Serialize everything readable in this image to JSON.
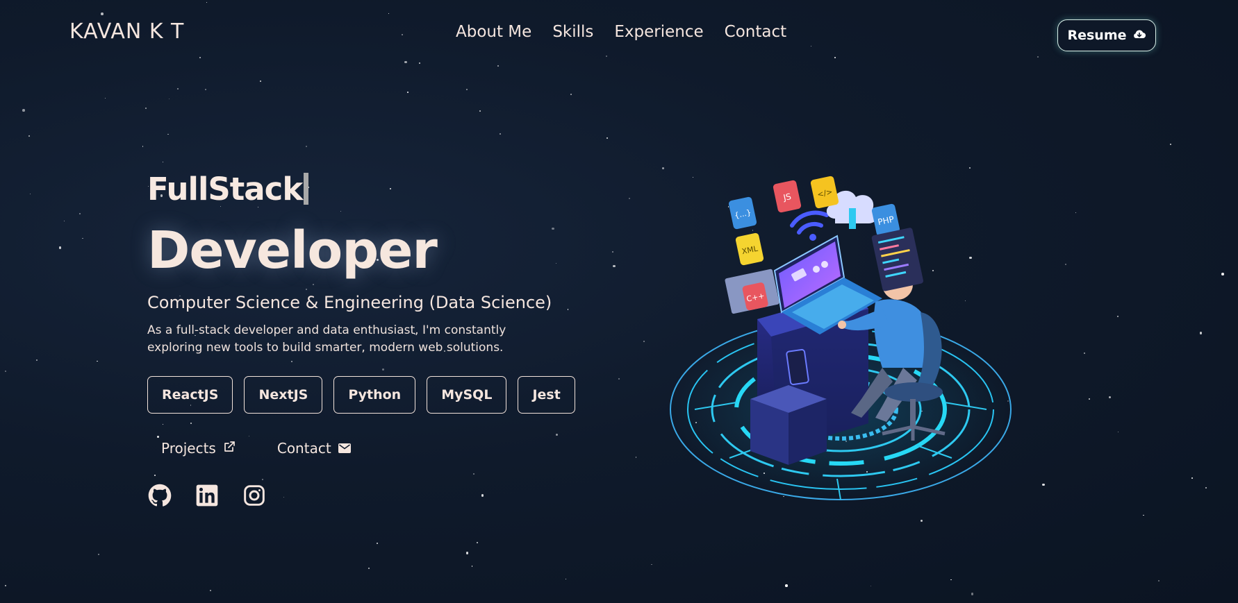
{
  "header": {
    "logo": "KAVAN K T",
    "nav": [
      "About Me",
      "Skills",
      "Experience",
      "Contact"
    ],
    "resume_label": "Resume",
    "resume_icon": "cloud-download-icon"
  },
  "hero": {
    "role_line_1": "FullStack",
    "role_line_2": "Developer",
    "degree": "Computer Science & Engineering (Data Science)",
    "bio": "As a full-stack developer and data enthusiast, I'm constantly exploring new tools to build smarter, modern web solutions.",
    "skills": [
      "ReactJS",
      "NextJS",
      "Python",
      "MySQL",
      "Jest"
    ],
    "links": [
      {
        "label": "Projects",
        "icon": "external-link-icon"
      },
      {
        "label": "Contact",
        "icon": "mail-icon"
      }
    ],
    "socials": [
      "github-icon",
      "linkedin-icon",
      "instagram-icon"
    ]
  },
  "illustration": {
    "badges": [
      "{...}",
      "JS",
      "</>",
      "XML",
      "PHP",
      "C++"
    ]
  },
  "colors": {
    "background": "#0f1a2b",
    "text": "#f5e6df",
    "accent_cyan": "#2ec9f0",
    "accent_purple": "#7a5cff"
  }
}
